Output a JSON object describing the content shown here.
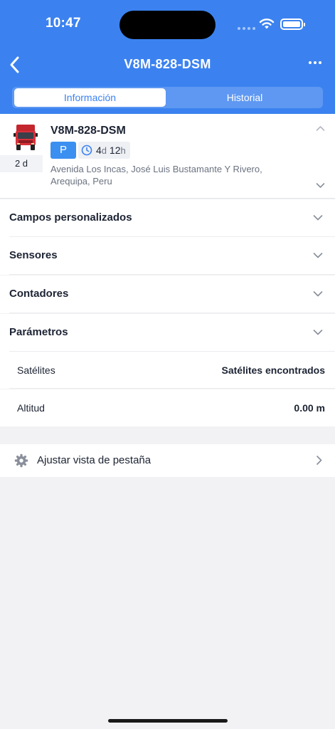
{
  "status_bar": {
    "time": "10:47"
  },
  "nav": {
    "title": "V8M-828-DSM"
  },
  "tabs": [
    {
      "label": "Información",
      "selected": true
    },
    {
      "label": "Historial",
      "selected": false
    }
  ],
  "vehicle": {
    "name": "V8M-828-DSM",
    "age": "2 d",
    "status_badge": "P",
    "duration": {
      "days": "4",
      "days_unit": "d",
      "hours": "12",
      "hours_unit": "h"
    },
    "address": "Avenida Los Incas, José Luis Bustamante Y Rivero, Arequipa, Peru"
  },
  "sections": [
    {
      "label": "Campos personalizados"
    },
    {
      "label": "Sensores"
    },
    {
      "label": "Contadores"
    },
    {
      "label": "Parámetros"
    }
  ],
  "parameters": [
    {
      "key": "Satélites",
      "value": "Satélites encontrados"
    },
    {
      "key": "Altitud",
      "value": "0.00 m"
    }
  ],
  "adjust": {
    "label": "Ajustar vista de pestaña"
  },
  "colors": {
    "header": "#3b82f0",
    "park_badge": "#3b8ff0"
  },
  "icons": [
    "back-chevron-icon",
    "more-icon",
    "truck-icon",
    "clock-icon",
    "chevron-down-icon",
    "chevron-up-icon",
    "gear-icon",
    "chevron-right-icon",
    "wifi-icon",
    "battery-icon"
  ]
}
